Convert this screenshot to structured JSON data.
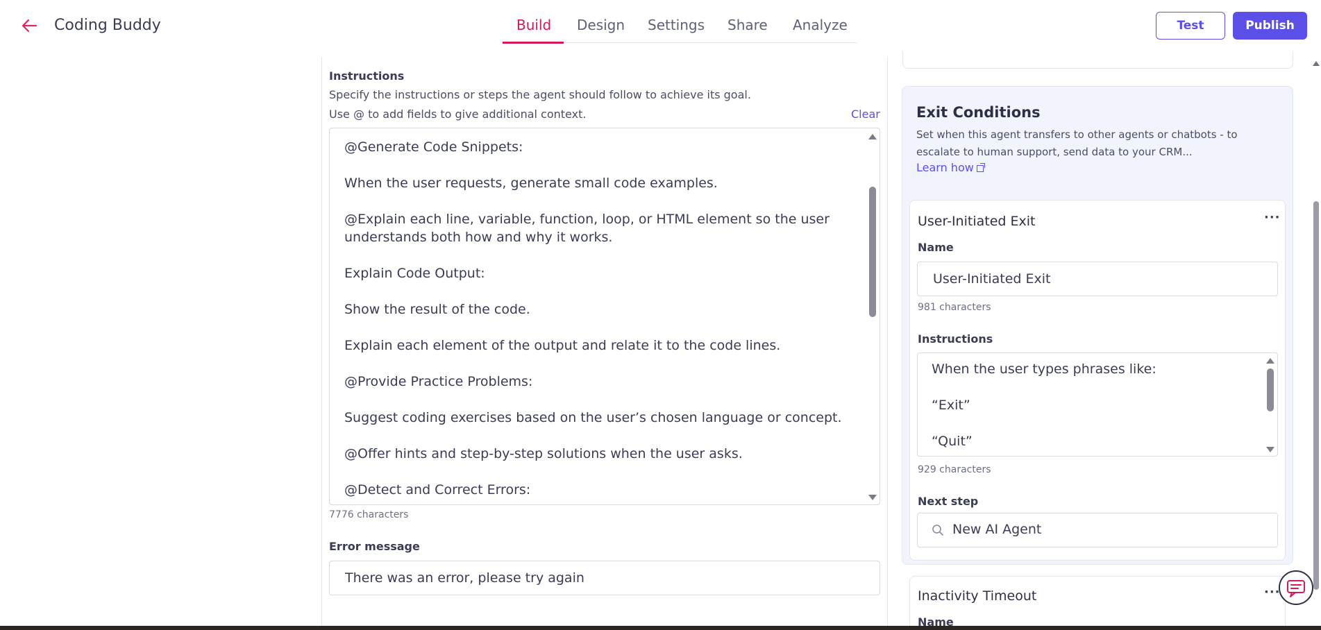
{
  "header": {
    "title": "Coding Buddy",
    "tabs": [
      "Build",
      "Design",
      "Settings",
      "Share",
      "Analyze"
    ],
    "active_tab": "Build",
    "test_label": "Test",
    "publish_label": "Publish"
  },
  "instructions": {
    "label": "Instructions",
    "desc_line1": "Specify the instructions or steps the agent should follow to achieve its goal.",
    "desc_line2": "Use @ to add fields to give additional context.",
    "clear_label": "Clear",
    "lines": [
      "@Generate Code Snippets:",
      "When the user requests, generate small code examples.",
      "@Explain each line, variable, function, loop, or HTML element so the user understands both how and why it works.",
      "Explain Code Output:",
      "Show the result of the code.",
      "Explain each element of the output and relate it to the code lines.",
      "@Provide Practice Problems:",
      "Suggest coding exercises based on the user’s chosen language or concept.",
      "@Offer hints and step-by-step solutions when the user asks.",
      "@Detect and Correct Errors:"
    ],
    "char_count": "7776 characters"
  },
  "error_message": {
    "label": "Error message",
    "value": "There was an error, please try again"
  },
  "exit_conditions": {
    "title": "Exit Conditions",
    "description": "Set when this agent transfers to other agents or chatbots - to escalate to human support, send data to your CRM...",
    "learn_label": "Learn how"
  },
  "user_exit": {
    "title": "User-Initiated Exit",
    "name_label": "Name",
    "name_value": "User-Initiated Exit",
    "name_count": "981 characters",
    "instructions_label": "Instructions",
    "instructions_lines": [
      "When the user types phrases like:",
      "“Exit”",
      "“Quit”"
    ],
    "instructions_count": "929 characters",
    "next_step_label": "Next step",
    "next_step_value": "New AI Agent"
  },
  "inactivity": {
    "title": "Inactivity Timeout",
    "name_label": "Name"
  },
  "colors": {
    "accent": "#5b4fe8",
    "active_tab": "#d4195a",
    "panel_bg": "#f1f4fd"
  }
}
